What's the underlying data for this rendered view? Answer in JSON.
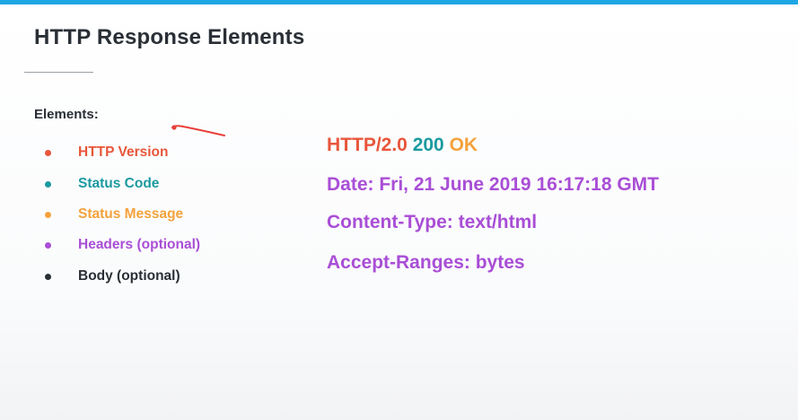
{
  "title": "HTTP Response Elements",
  "elements_label": "Elements:",
  "elements": [
    {
      "label": "HTTP Version",
      "color": "#e8563b"
    },
    {
      "label": "Status Code",
      "color": "#1c9a9f"
    },
    {
      "label": "Status Message",
      "color": "#f4a23c"
    },
    {
      "label": "Headers (optional)",
      "color": "#a94ed6"
    },
    {
      "label": "Body (optional)",
      "color": "#2a2f36"
    }
  ],
  "response": {
    "version": "HTTP/2.0",
    "status_code": "200",
    "status_message": "OK",
    "headers": [
      "Date: Fri, 21 June 2019 16:17:18 GMT",
      "Content-Type: text/html",
      "Accept-Ranges: bytes"
    ]
  },
  "colors": {
    "accent_bar": "#1ea7e4",
    "version": "#e8563b",
    "status_code": "#1c9a9f",
    "status_message": "#f4a23c",
    "headers": "#a94ed6",
    "body": "#2a2f36"
  }
}
